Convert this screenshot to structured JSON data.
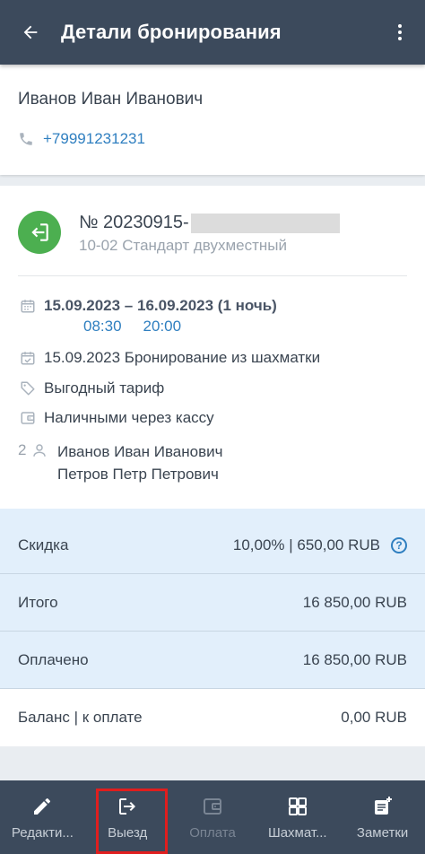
{
  "appbar": {
    "title": "Детали бронирования"
  },
  "guest": {
    "name": "Иванов Иван Иванович",
    "phone": "+79991231231"
  },
  "booking": {
    "number": "№ 20230915-",
    "room": "10-02 Стандарт двухместный",
    "dates": "15.09.2023 – 16.09.2023 (1 ночь)",
    "checkin_time": "08:30",
    "checkout_time": "20:00",
    "created": "15.09.2023 Бронирование из шахматки",
    "tariff": "Выгодный тариф",
    "payment_method": "Наличными через кассу",
    "guests_count": "2",
    "guests": [
      "Иванов Иван Иванович",
      "Петров Петр Петрович"
    ]
  },
  "summary": [
    {
      "label": "Скидка",
      "value": "10,00% | 650,00 RUB"
    },
    {
      "label": "Итого",
      "value": "16 850,00 RUB"
    },
    {
      "label": "Оплачено",
      "value": "16 850,00 RUB"
    },
    {
      "label": "Баланс | к оплате",
      "value": "0,00 RUB"
    }
  ],
  "nav": [
    {
      "label": "Редакти...",
      "icon": "edit-icon"
    },
    {
      "label": "Выезд",
      "icon": "checkout-icon"
    },
    {
      "label": "Оплата",
      "icon": "wallet-icon"
    },
    {
      "label": "Шахмат...",
      "icon": "grid-icon"
    },
    {
      "label": "Заметки",
      "icon": "note-add-icon"
    }
  ],
  "colors": {
    "appbar": "#3c4a5c",
    "accent": "#2f7fc0",
    "status_green": "#4caf50",
    "summary_bg": "#e2effb",
    "highlight": "#e01e1e"
  }
}
